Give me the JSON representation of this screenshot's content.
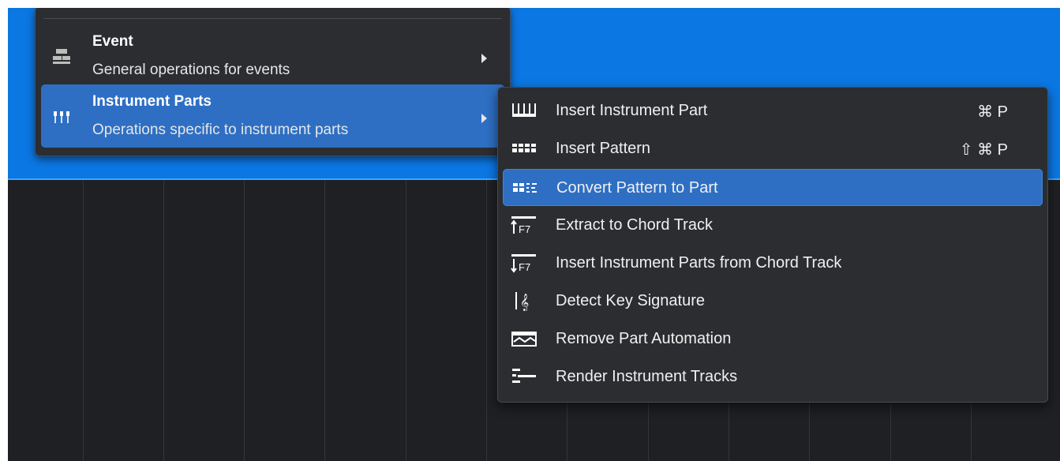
{
  "main_menu": {
    "categories": [
      {
        "title": "Event",
        "subtitle": "General operations for events",
        "icon": "event-icon"
      },
      {
        "title": "Instrument Parts",
        "subtitle": "Operations specific to instrument parts",
        "icon": "piano-keys-icon"
      }
    ]
  },
  "submenu": {
    "items": [
      {
        "label": "Insert Instrument Part",
        "shortcut": "⌘ P",
        "icon": "keyboard-icon"
      },
      {
        "label": "Insert Pattern",
        "shortcut": "⇧ ⌘ P",
        "icon": "pattern-icon"
      },
      {
        "label": "Convert Pattern to Part",
        "shortcut": "",
        "icon": "convert-pattern-icon"
      },
      {
        "label": "Extract to Chord Track",
        "shortcut": "",
        "icon": "extract-chord-icon"
      },
      {
        "label": "Insert Instrument Parts from Chord Track",
        "shortcut": "",
        "icon": "insert-from-chord-icon"
      },
      {
        "label": "Detect Key Signature",
        "shortcut": "",
        "icon": "treble-clef-icon"
      },
      {
        "label": "Remove Part Automation",
        "shortcut": "",
        "icon": "automation-icon"
      },
      {
        "label": "Render Instrument Tracks",
        "shortcut": "",
        "icon": "render-tracks-icon"
      }
    ],
    "highlighted_index": 2
  },
  "colors": {
    "highlight": "#2e6fc4",
    "timeline_band": "#0b77e3",
    "menu_background": "#2c2d30",
    "arrangement_background": "#1f2024"
  }
}
